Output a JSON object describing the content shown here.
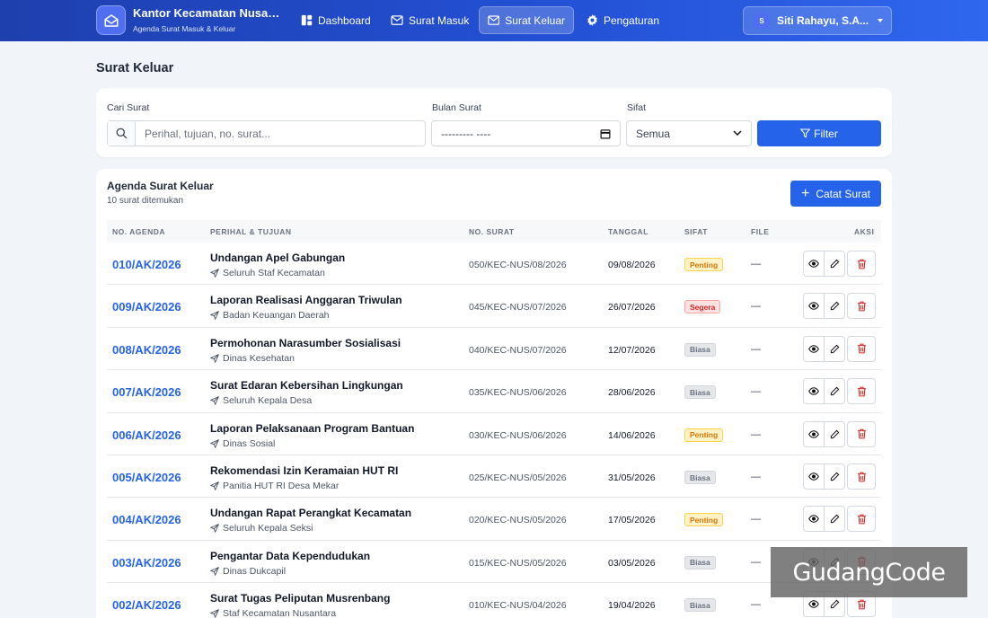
{
  "header": {
    "brand_title": "Kantor Kecamatan Nusan...",
    "brand_subtitle": "Agenda Surat Masuk & Keluar",
    "nav": [
      {
        "label": "Dashboard",
        "icon": "dashboard-icon"
      },
      {
        "label": "Surat Masuk",
        "icon": "inbox-mail-icon"
      },
      {
        "label": "Surat Keluar",
        "icon": "outbox-mail-icon",
        "active": true
      },
      {
        "label": "Pengaturan",
        "icon": "gear-icon"
      }
    ],
    "user_initial": "S",
    "user_name": "Siti Rahayu, S.A..."
  },
  "page_title": "Surat Keluar",
  "filter": {
    "search_label": "Cari Surat",
    "search_placeholder": "Perihal, tujuan, no. surat...",
    "month_label": "Bulan Surat",
    "month_value": "--------- ----",
    "sifat_label": "Sifat",
    "sifat_value": "Semua",
    "filter_button": "Filter"
  },
  "table": {
    "title": "Agenda Surat Keluar",
    "count_text": "10 surat ditemukan",
    "add_button": "Catat Surat",
    "columns": [
      "NO. AGENDA",
      "PERIHAL & TUJUAN",
      "NO. SURAT",
      "TANGGAL",
      "SIFAT",
      "FILE",
      "AKSI"
    ],
    "rows": [
      {
        "agenda": "010/AK/2026",
        "perihal": "Undangan Apel Gabungan",
        "tujuan": "Seluruh Staf Kecamatan",
        "no_surat": "050/KEC-NUS/08/2026",
        "tanggal": "09/08/2026",
        "sifat": "Penting",
        "file": "—"
      },
      {
        "agenda": "009/AK/2026",
        "perihal": "Laporan Realisasi Anggaran Triwulan",
        "tujuan": "Badan Keuangan Daerah",
        "no_surat": "045/KEC-NUS/07/2026",
        "tanggal": "26/07/2026",
        "sifat": "Segera",
        "file": "—"
      },
      {
        "agenda": "008/AK/2026",
        "perihal": "Permohonan Narasumber Sosialisasi",
        "tujuan": "Dinas Kesehatan",
        "no_surat": "040/KEC-NUS/07/2026",
        "tanggal": "12/07/2026",
        "sifat": "Biasa",
        "file": "—"
      },
      {
        "agenda": "007/AK/2026",
        "perihal": "Surat Edaran Kebersihan Lingkungan",
        "tujuan": "Seluruh Kepala Desa",
        "no_surat": "035/KEC-NUS/06/2026",
        "tanggal": "28/06/2026",
        "sifat": "Biasa",
        "file": "—"
      },
      {
        "agenda": "006/AK/2026",
        "perihal": "Laporan Pelaksanaan Program Bantuan",
        "tujuan": "Dinas Sosial",
        "no_surat": "030/KEC-NUS/06/2026",
        "tanggal": "14/06/2026",
        "sifat": "Penting",
        "file": "—"
      },
      {
        "agenda": "005/AK/2026",
        "perihal": "Rekomendasi Izin Keramaian HUT RI",
        "tujuan": "Panitia HUT RI Desa Mekar",
        "no_surat": "025/KEC-NUS/05/2026",
        "tanggal": "31/05/2026",
        "sifat": "Biasa",
        "file": "—"
      },
      {
        "agenda": "004/AK/2026",
        "perihal": "Undangan Rapat Perangkat Kecamatan",
        "tujuan": "Seluruh Kepala Seksi",
        "no_surat": "020/KEC-NUS/05/2026",
        "tanggal": "17/05/2026",
        "sifat": "Penting",
        "file": "—"
      },
      {
        "agenda": "003/AK/2026",
        "perihal": "Pengantar Data Kependudukan",
        "tujuan": "Dinas Dukcapil",
        "no_surat": "015/KEC-NUS/05/2026",
        "tanggal": "03/05/2026",
        "sifat": "Biasa",
        "file": "—"
      },
      {
        "agenda": "002/AK/2026",
        "perihal": "Surat Tugas Peliputan Musrenbang",
        "tujuan": "Staf Kecamatan Nusantara",
        "no_surat": "010/KEC-NUS/04/2026",
        "tanggal": "19/04/2026",
        "sifat": "Biasa",
        "file": "—"
      }
    ]
  },
  "badge_colors": {
    "Penting": {
      "bg": "#fef3c7",
      "fg": "#d97706",
      "border": "#fcd34d"
    },
    "Segera": {
      "bg": "#fee2e2",
      "fg": "#dc2626",
      "border": "#fca5a5"
    },
    "Biasa": {
      "bg": "#e5e7eb",
      "fg": "#6b7280",
      "border": "#d1d5db"
    }
  },
  "watermark": "GudangCode"
}
